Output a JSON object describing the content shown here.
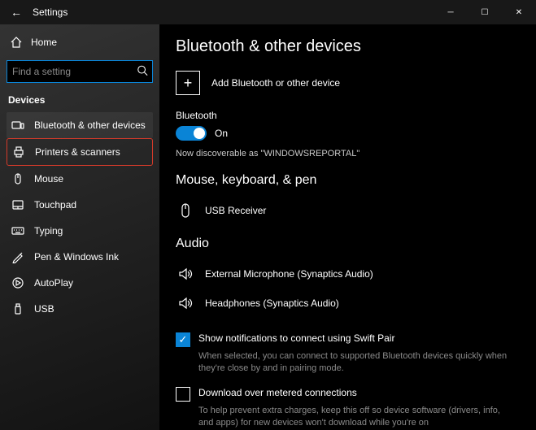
{
  "titlebar": {
    "title": "Settings"
  },
  "sidebar": {
    "home": "Home",
    "search_placeholder": "Find a setting",
    "category": "Devices",
    "items": [
      {
        "label": "Bluetooth & other devices"
      },
      {
        "label": "Printers & scanners"
      },
      {
        "label": "Mouse"
      },
      {
        "label": "Touchpad"
      },
      {
        "label": "Typing"
      },
      {
        "label": "Pen & Windows Ink"
      },
      {
        "label": "AutoPlay"
      },
      {
        "label": "USB"
      }
    ]
  },
  "main": {
    "heading": "Bluetooth & other devices",
    "add_label": "Add Bluetooth or other device",
    "bt_label": "Bluetooth",
    "bt_state": "On",
    "discoverable": "Now discoverable as \"WINDOWSREPORTAL\"",
    "section_mouse": "Mouse, keyboard, & pen",
    "device_usb": "USB Receiver",
    "section_audio": "Audio",
    "device_mic": "External Microphone (Synaptics Audio)",
    "device_hp": "Headphones (Synaptics Audio)",
    "swift_pair": "Show notifications to connect using Swift Pair",
    "swift_pair_hint": "When selected, you can connect to supported Bluetooth devices quickly when they're close by and in pairing mode.",
    "metered": "Download over metered connections",
    "metered_hint": "To help prevent extra charges, keep this off so device software (drivers, info, and apps) for new devices won't download while you're on"
  }
}
